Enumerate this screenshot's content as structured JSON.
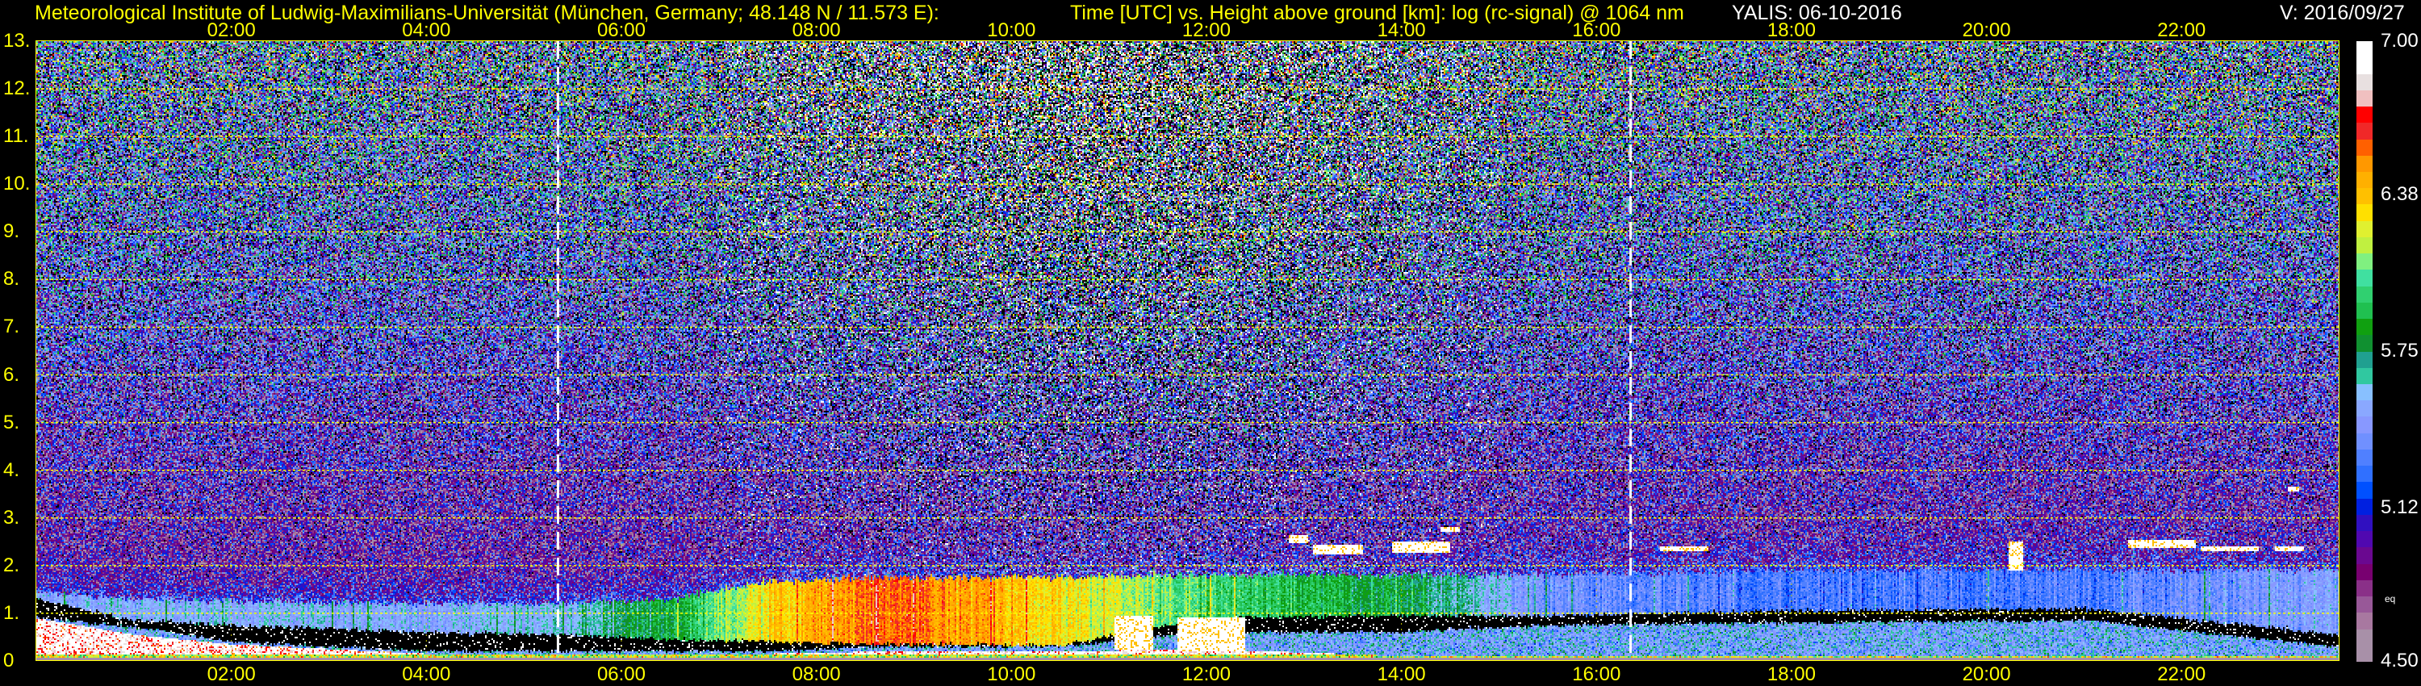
{
  "header": {
    "institute": "Meteorological Institute of Ludwig-Maximilians-Universität (München, Germany; 48.148 N / 11.573 E):",
    "description": "Time [UTC] vs. Height above ground [km]: log (rc-signal) @ 1064 nm",
    "instrument_date": "YALIS: 06-10-2016",
    "version": "V: 2016/09/27"
  },
  "chart_data": {
    "type": "heatmap",
    "title": "Time [UTC] vs. Height above ground [km]: log (rc-signal) @ 1064 nm",
    "xlabel": "Time [UTC]",
    "ylabel": "Height above ground [km]",
    "xlim": [
      0,
      23.62
    ],
    "ylim": [
      0,
      13
    ],
    "x_ticks": [
      {
        "value": 2,
        "label": "02:00"
      },
      {
        "value": 4,
        "label": "04:00"
      },
      {
        "value": 6,
        "label": "06:00"
      },
      {
        "value": 8,
        "label": "08:00"
      },
      {
        "value": 10,
        "label": "10:00"
      },
      {
        "value": 12,
        "label": "12:00"
      },
      {
        "value": 14,
        "label": "14:00"
      },
      {
        "value": 16,
        "label": "16:00"
      },
      {
        "value": 18,
        "label": "18:00"
      },
      {
        "value": 20,
        "label": "20:00"
      },
      {
        "value": 22,
        "label": "22:00"
      }
    ],
    "y_ticks": [
      {
        "value": 0,
        "label": "0"
      },
      {
        "value": 1,
        "label": "1."
      },
      {
        "value": 2,
        "label": "2."
      },
      {
        "value": 3,
        "label": "3."
      },
      {
        "value": 4,
        "label": "4."
      },
      {
        "value": 5,
        "label": "5."
      },
      {
        "value": 6,
        "label": "6."
      },
      {
        "value": 7,
        "label": "7."
      },
      {
        "value": 8,
        "label": "8."
      },
      {
        "value": 9,
        "label": "9."
      },
      {
        "value": 10,
        "label": "10."
      },
      {
        "value": 11,
        "label": "11."
      },
      {
        "value": 12,
        "label": "12."
      },
      {
        "value": 13,
        "label": "13."
      }
    ],
    "grid": true,
    "vertical_markers_utc_hours": [
      5.35,
      16.35
    ],
    "colorbar": {
      "range": [
        4.5,
        7.0
      ],
      "ticks": [
        {
          "value": 7.0,
          "label": "7.00"
        },
        {
          "value": 6.38,
          "label": "6.38"
        },
        {
          "value": 5.75,
          "label": "5.75"
        },
        {
          "value": 5.12,
          "label": "5.12"
        },
        {
          "value": 4.5,
          "label": "4.50"
        }
      ],
      "note": "eq",
      "colors_low_to_high": [
        "#a890a8",
        "#a890a8",
        "#a878a0",
        "#985898",
        "#8a3088",
        "#780070",
        "#6a0890",
        "#5008b0",
        "#3010c0",
        "#0020e0",
        "#0050ff",
        "#3070ff",
        "#5080ff",
        "#7090ff",
        "#8898ff",
        "#8aa8ff",
        "#88c0ff",
        "#30c8a0",
        "#20a090",
        "#109030",
        "#10a010",
        "#20c050",
        "#30d070",
        "#40e0a0",
        "#80f080",
        "#c0f040",
        "#e0f030",
        "#ffe000",
        "#ffc000",
        "#ffb000",
        "#ff9800",
        "#ff6000",
        "#f02828",
        "#ff0000",
        "#f0c0c0",
        "#e8e0e0",
        "#ffffff",
        "#ffffff"
      ],
      "below_range_color": "#000000"
    },
    "aerosol_layer_keyframes": [
      {
        "t": 0.0,
        "top_km": 1.45,
        "value": 5.5,
        "gap_bottom_km": 0.9,
        "gap_top_km": 1.3,
        "surface_top_km": 0.9
      },
      {
        "t": 1.0,
        "top_km": 1.3,
        "value": 5.55,
        "gap_bottom_km": 0.72,
        "gap_top_km": 0.85,
        "surface_top_km": 0.55
      },
      {
        "t": 2.0,
        "top_km": 1.25,
        "value": 5.55,
        "gap_bottom_km": 0.4,
        "gap_top_km": 0.75,
        "surface_top_km": 0.35
      },
      {
        "t": 4.0,
        "top_km": 1.2,
        "value": 5.5,
        "gap_bottom_km": 0.2,
        "gap_top_km": 0.6,
        "surface_top_km": 0.15
      },
      {
        "t": 5.5,
        "top_km": 1.2,
        "value": 5.6,
        "gap_bottom_km": 0.2,
        "gap_top_km": 0.55,
        "surface_top_km": 0.15
      },
      {
        "t": 6.5,
        "top_km": 1.3,
        "value": 5.85,
        "gap_bottom_km": 0.2,
        "gap_top_km": 0.45,
        "surface_top_km": 0.15
      },
      {
        "t": 7.5,
        "top_km": 1.65,
        "value": 6.3,
        "gap_bottom_km": 0.2,
        "gap_top_km": 0.4,
        "surface_top_km": 0.15
      },
      {
        "t": 8.7,
        "top_km": 1.75,
        "value": 6.6,
        "gap_bottom_km": 0.3,
        "gap_top_km": 0.35,
        "surface_top_km": 0.2
      },
      {
        "t": 10.5,
        "top_km": 1.75,
        "value": 6.3,
        "gap_bottom_km": 0.3,
        "gap_top_km": 0.32,
        "surface_top_km": 0.2
      },
      {
        "t": 12.0,
        "top_km": 1.8,
        "value": 6.0,
        "gap_bottom_km": 0.6,
        "gap_top_km": 0.9,
        "surface_top_km": 0.25
      },
      {
        "t": 14.0,
        "top_km": 1.8,
        "value": 5.8,
        "gap_bottom_km": 0.6,
        "gap_top_km": 0.95,
        "surface_top_km": 0.1
      },
      {
        "t": 15.5,
        "top_km": 1.8,
        "value": 5.4,
        "gap_bottom_km": 0.75,
        "gap_top_km": 0.95,
        "surface_top_km": 0.1
      },
      {
        "t": 18.0,
        "top_km": 1.9,
        "value": 5.3,
        "gap_bottom_km": 0.8,
        "gap_top_km": 1.05,
        "surface_top_km": 0.1
      },
      {
        "t": 21.0,
        "top_km": 1.9,
        "value": 5.3,
        "gap_bottom_km": 0.85,
        "gap_top_km": 1.1,
        "surface_top_km": 0.1
      },
      {
        "t": 23.62,
        "top_km": 1.9,
        "value": 5.5,
        "gap_bottom_km": 0.3,
        "gap_top_km": 0.55,
        "surface_top_km": 0.1
      }
    ],
    "cloud_features": [
      {
        "t": 11.25,
        "h_km": 0.6,
        "dt": 0.2,
        "dh_km": 0.35
      },
      {
        "t": 12.05,
        "h_km": 0.55,
        "dt": 0.35,
        "dh_km": 0.35
      },
      {
        "t": 12.95,
        "h_km": 2.55,
        "dt": 0.1,
        "dh_km": 0.08
      },
      {
        "t": 13.35,
        "h_km": 2.35,
        "dt": 0.25,
        "dh_km": 0.1
      },
      {
        "t": 14.2,
        "h_km": 2.4,
        "dt": 0.3,
        "dh_km": 0.12
      },
      {
        "t": 14.5,
        "h_km": 2.75,
        "dt": 0.1,
        "dh_km": 0.05
      },
      {
        "t": 16.9,
        "h_km": 2.35,
        "dt": 0.25,
        "dh_km": 0.05
      },
      {
        "t": 20.3,
        "h_km": 2.2,
        "dt": 0.08,
        "dh_km": 0.3
      },
      {
        "t": 21.8,
        "h_km": 2.45,
        "dt": 0.35,
        "dh_km": 0.08
      },
      {
        "t": 22.5,
        "h_km": 2.35,
        "dt": 0.3,
        "dh_km": 0.05
      },
      {
        "t": 23.1,
        "h_km": 2.35,
        "dt": 0.15,
        "dh_km": 0.05
      },
      {
        "t": 23.15,
        "h_km": 3.6,
        "dt": 0.06,
        "dh_km": 0.04
      }
    ]
  }
}
